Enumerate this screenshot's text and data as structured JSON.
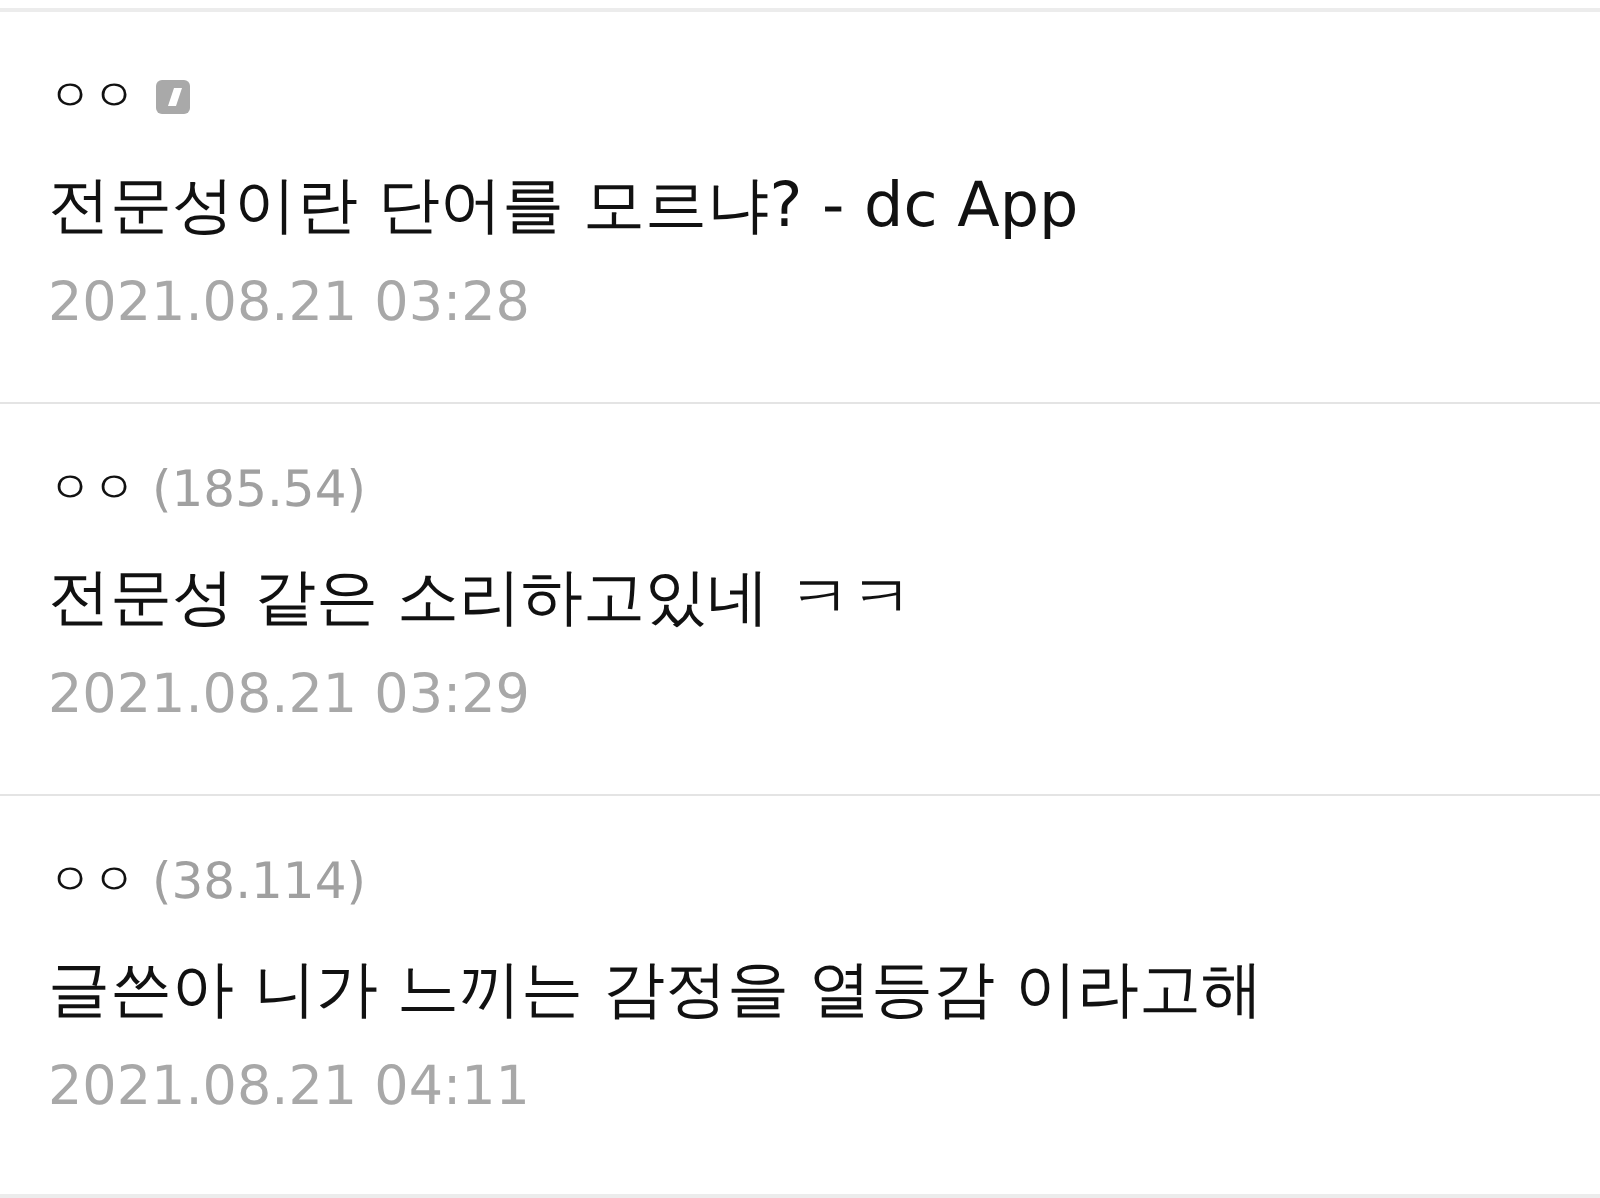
{
  "comments": [
    {
      "author": "ㅇㅇ",
      "app_badge": true,
      "text": "전문성이란 단어를 모르냐? - dc App",
      "date": "2021.08.21 03:28"
    },
    {
      "author": "ㅇㅇ",
      "app_badge": false,
      "ip": "(185.54)",
      "text": "전문성 같은 소리하고있네 ㅋㅋ",
      "date": "2021.08.21 03:29"
    },
    {
      "author": "ㅇㅇ",
      "app_badge": false,
      "ip": "(38.114)",
      "text": "글쓴아 니가 느끼는 감정을 열등감 이라고해",
      "date": "2021.08.21 04:11"
    }
  ]
}
